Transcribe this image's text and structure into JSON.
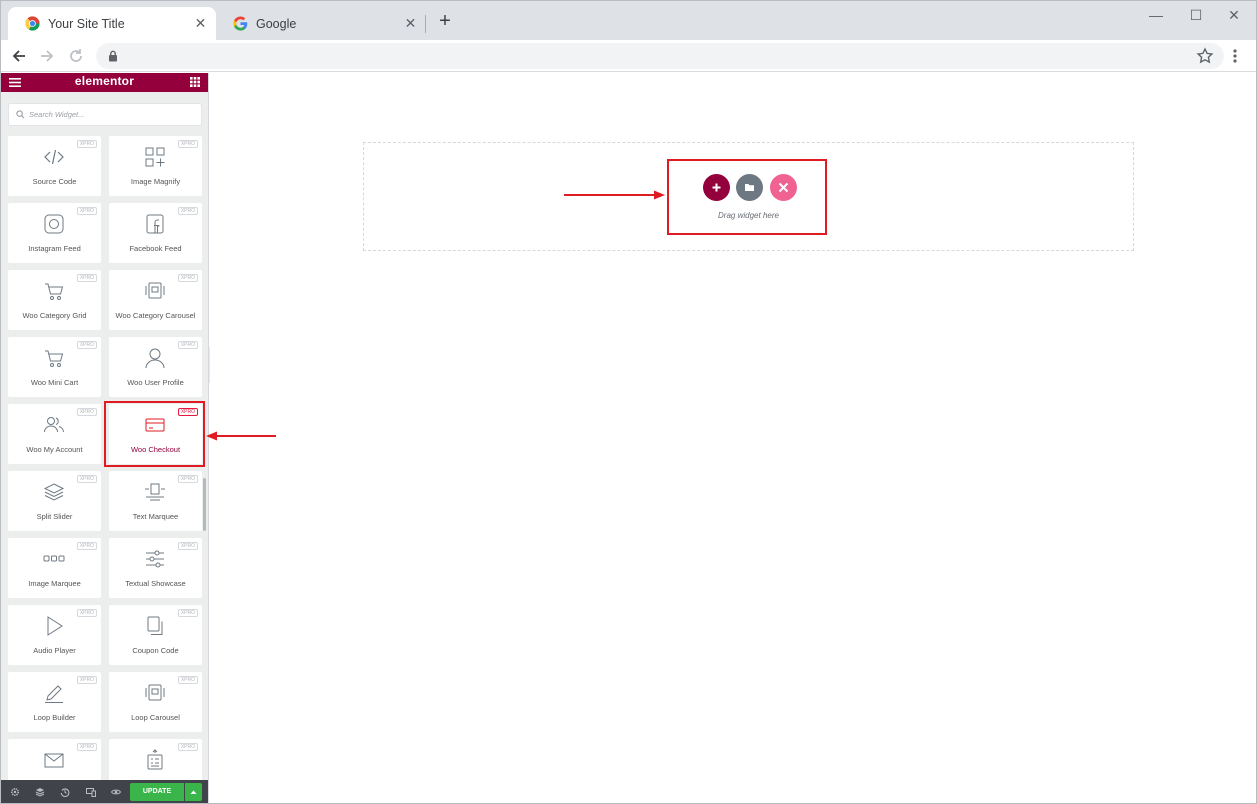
{
  "browser": {
    "tabs": [
      {
        "title": "Your Site Title",
        "active": true,
        "favicon": "chrome-icon"
      },
      {
        "title": "Google",
        "active": false,
        "favicon": "google-g-icon"
      }
    ],
    "new_tab_label": "+",
    "url": ""
  },
  "panel": {
    "brand": "elementor",
    "brand_color": "#93003c",
    "search_placeholder": "Search Widget...",
    "pro_badge": "XPRO",
    "widgets": [
      {
        "label": "Source Code",
        "icon": "code-icon"
      },
      {
        "label": "Image Magnify",
        "icon": "grid-plus-icon"
      },
      {
        "label": "Instagram Feed",
        "icon": "instagram-icon"
      },
      {
        "label": "Facebook Feed",
        "icon": "facebook-icon"
      },
      {
        "label": "Woo Category Grid",
        "icon": "cart-icon"
      },
      {
        "label": "Woo Category Carousel",
        "icon": "carousel-icon"
      },
      {
        "label": "Woo Mini Cart",
        "icon": "cart-icon"
      },
      {
        "label": "Woo User Profile",
        "icon": "user-icon"
      },
      {
        "label": "Woo My Account",
        "icon": "users-icon"
      },
      {
        "label": "Woo Checkout",
        "icon": "credit-card-icon",
        "highlighted": true
      },
      {
        "label": "Split Slider",
        "icon": "layers-icon"
      },
      {
        "label": "Text Marquee",
        "icon": "marquee-icon"
      },
      {
        "label": "Image Marquee",
        "icon": "image-marquee-icon"
      },
      {
        "label": "Textual Showcase",
        "icon": "sliders-icon"
      },
      {
        "label": "Audio Player",
        "icon": "play-icon"
      },
      {
        "label": "Coupon Code",
        "icon": "copy-icon"
      },
      {
        "label": "Loop Builder",
        "icon": "pencil-icon"
      },
      {
        "label": "Loop Carousel",
        "icon": "carousel-icon"
      },
      {
        "label": "",
        "icon": "mail-icon"
      },
      {
        "label": "",
        "icon": "form-icon"
      }
    ],
    "footer": {
      "update_label": "UPDATE",
      "update_color": "#39b54a"
    }
  },
  "canvas": {
    "drop_label": "Drag widget here",
    "buttons": [
      {
        "name": "add-section",
        "color": "#93003c"
      },
      {
        "name": "template-library",
        "color": "#6d7882"
      },
      {
        "name": "xpro-templates",
        "color": "#f06292"
      }
    ]
  },
  "annotation_color": "#e11b22"
}
